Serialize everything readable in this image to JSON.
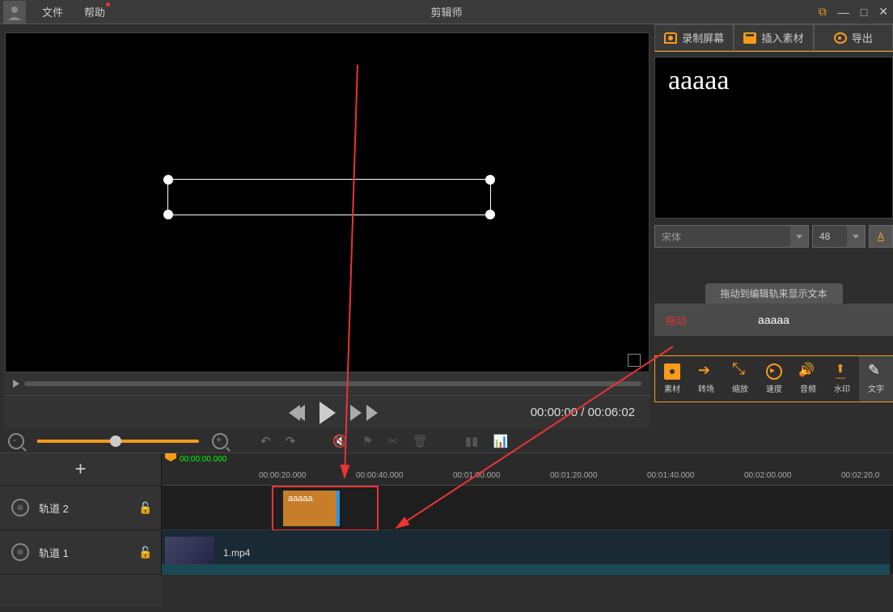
{
  "app": {
    "title": "剪辑师"
  },
  "menu": {
    "file": "文件",
    "help": "帮助"
  },
  "topButtons": {
    "record": "录制屏幕",
    "insert": "插入素材",
    "export": "导出"
  },
  "text": {
    "sample": "aaaaa",
    "font": "宋体",
    "size": "48"
  },
  "hint": {
    "tab": "拖动到编辑轨来显示文本",
    "drag": "拖动",
    "label": "aaaaa"
  },
  "tools": {
    "media": "素材",
    "trans": "转场",
    "scale": "缩放",
    "speed": "速度",
    "audio": "音频",
    "water": "水印",
    "text": "文字"
  },
  "transport": {
    "time": "00:00:00 / 00:06:02"
  },
  "ruler": {
    "playhead": "00:00:00.000",
    "t1": "00:00:20.000",
    "t2": "00:00:40.000",
    "t3": "00:01:00.000",
    "t4": "00:01:20.000",
    "t5": "00:01:40.000",
    "t6": "00:02:00.000",
    "t7": "00:02:20.0"
  },
  "tracks": {
    "t2": "轨道 2",
    "t1": "轨道 1"
  },
  "clip": {
    "text": "aaaaa",
    "video": "1.mp4"
  }
}
